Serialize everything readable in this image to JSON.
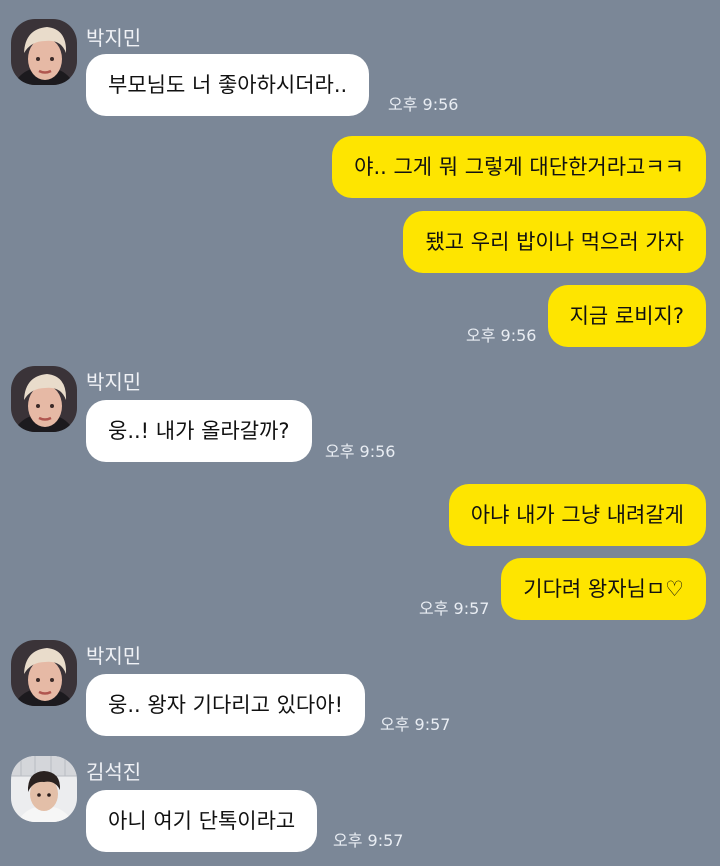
{
  "messages": [
    {
      "sender": "박지민",
      "avatar": "jimin-avatar",
      "text": "부모님도 너 좋아하시더라..",
      "time": "오후 9:56"
    },
    {
      "sender": "me",
      "text": "야.. 그게 뭐 그렇게 대단한거라고ㅋㅋ"
    },
    {
      "sender": "me",
      "text": "됐고 우리 밥이나 먹으러 가자"
    },
    {
      "sender": "me",
      "text": "지금 로비지?",
      "time": "오후 9:56"
    },
    {
      "sender": "박지민",
      "avatar": "jimin-avatar",
      "text": "웅..! 내가 올라갈까?",
      "time": "오후 9:56"
    },
    {
      "sender": "me",
      "text": "아냐 내가 그냥 내려갈게"
    },
    {
      "sender": "me",
      "text": "기다려 왕자님ㅁ♡",
      "time": "오후 9:57"
    },
    {
      "sender": "박지민",
      "avatar": "jimin-avatar",
      "text": "웅.. 왕자 기다리고 있다아!",
      "time": "오후 9:57"
    },
    {
      "sender": "김석진",
      "avatar": "seokjin-avatar",
      "text": "아니 여기 단톡이라고",
      "time": "오후 9:57"
    }
  ],
  "colors": {
    "background": "#7b8797",
    "incoming_bubble": "#ffffff",
    "outgoing_bubble": "#fee500"
  }
}
